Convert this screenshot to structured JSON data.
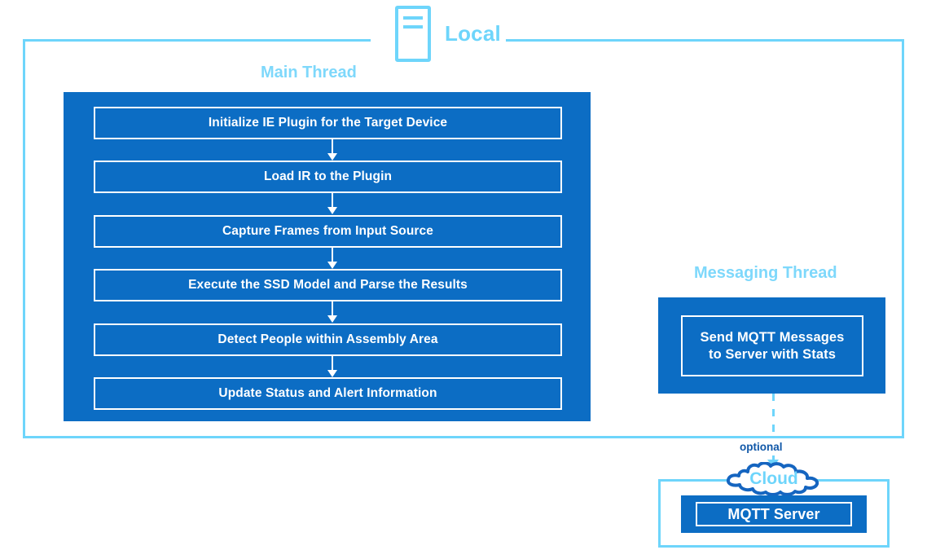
{
  "diagram": {
    "title": "Local",
    "colors": {
      "accent_light_blue": "#6ed5fb",
      "panel_blue": "#0c6dc4",
      "optional_text_blue": "#1158a8",
      "box_text": "#ffffff",
      "background": "#ffffff"
    },
    "local_zone": {
      "label": "Local",
      "icon": "server-icon",
      "main_thread": {
        "label": "Main Thread",
        "steps": [
          "Initialize IE Plugin for the Target Device",
          "Load IR to the Plugin",
          "Capture Frames from Input Source",
          "Execute the SSD Model and Parse the Results",
          "Detect People within Assembly Area",
          "Update Status and Alert Information"
        ]
      },
      "messaging_thread": {
        "label": "Messaging Thread",
        "steps": [
          {
            "line1": "Send MQTT Messages",
            "line2": "to Server with Stats"
          }
        ]
      }
    },
    "connector": {
      "label": "optional",
      "style": "dashed",
      "direction": "down"
    },
    "cloud_zone": {
      "label": "Cloud",
      "steps": [
        "MQTT Server"
      ]
    }
  }
}
